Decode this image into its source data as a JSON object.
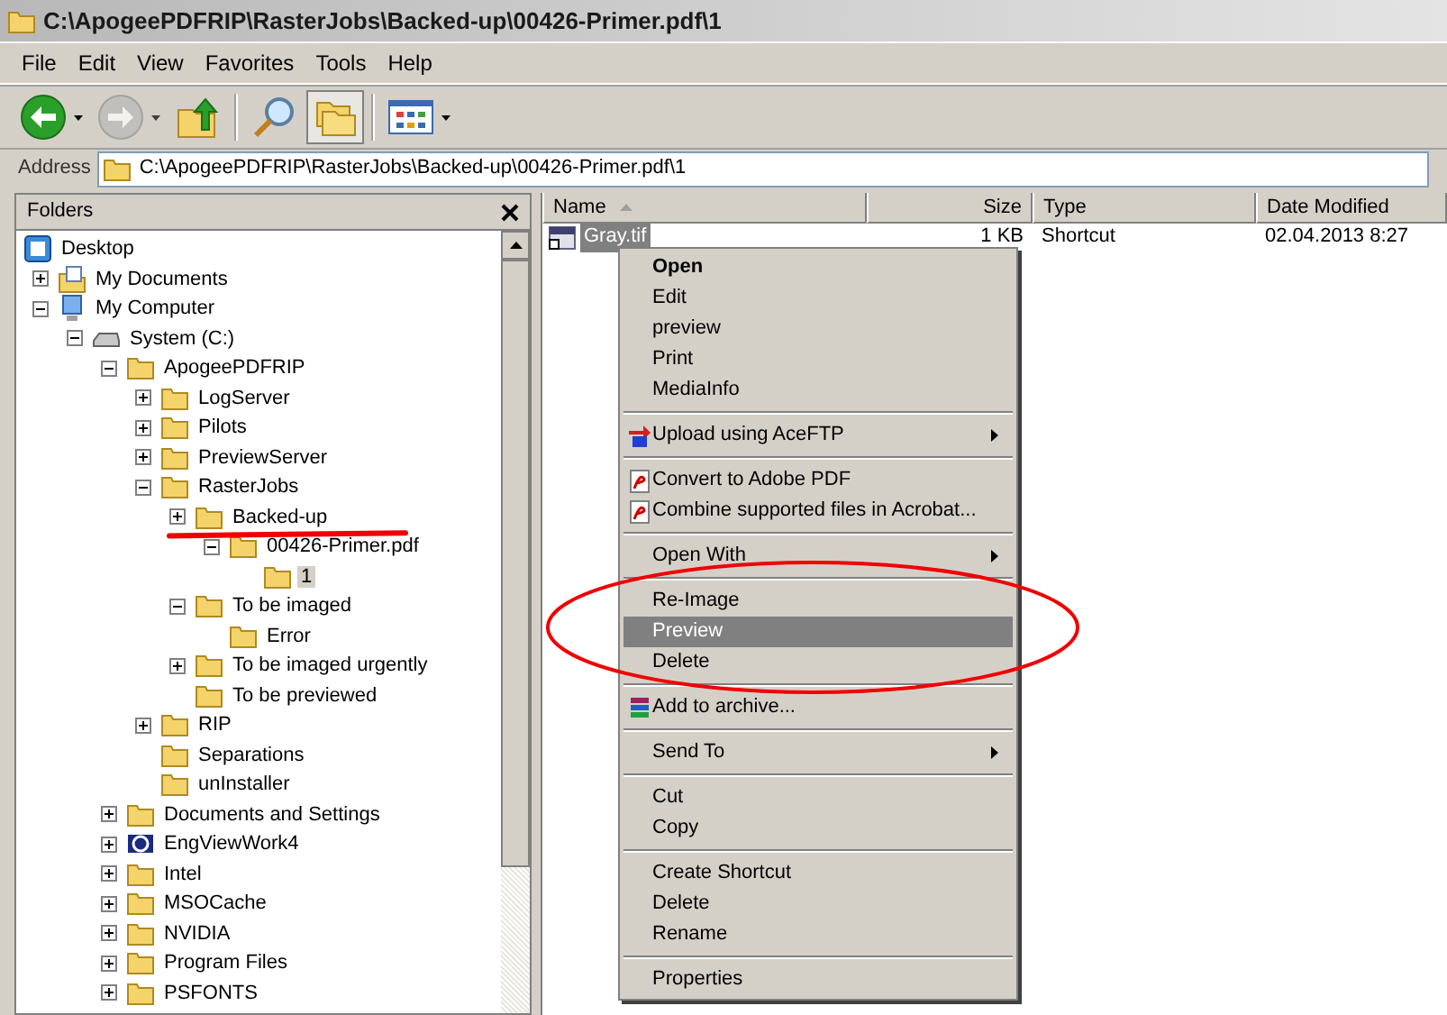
{
  "window": {
    "title": "C:\\ApogeePDFRIP\\RasterJobs\\Backed-up\\00426-Primer.pdf\\1"
  },
  "menu_bar": [
    "File",
    "Edit",
    "View",
    "Favorites",
    "Tools",
    "Help"
  ],
  "toolbar": [
    {
      "kind": "back",
      "disabled": false,
      "on": false
    },
    {
      "kind": "forward",
      "disabled": true,
      "on": false
    },
    {
      "kind": "up",
      "disabled": false,
      "on": false
    },
    {
      "kind": "search",
      "disabled": false,
      "on": false
    },
    {
      "kind": "folders",
      "disabled": false,
      "on": true
    },
    {
      "kind": "views",
      "disabled": false,
      "on": false
    }
  ],
  "address_bar": {
    "label": "Address",
    "value": "C:\\ApogeePDFRIP\\RasterJobs\\Backed-up\\00426-Primer.pdf\\1"
  },
  "folders_pane": {
    "title": "Folders",
    "tree": [
      {
        "label": "Desktop",
        "kind": "desktop",
        "selected": false,
        "children": [
          {
            "label": "My Documents",
            "kind": "documents",
            "expanded": false,
            "selected": false
          },
          {
            "label": "My Computer",
            "kind": "computer",
            "expanded": true,
            "selected": false,
            "children": [
              {
                "label": "System (C:)",
                "kind": "drive",
                "expanded": true,
                "selected": false,
                "children": [
                  {
                    "label": "ApogeePDFRIP",
                    "kind": "folder",
                    "expanded": true,
                    "selected": false,
                    "children": [
                      {
                        "label": "LogServer",
                        "kind": "folder",
                        "expanded": false,
                        "selected": false
                      },
                      {
                        "label": "Pilots",
                        "kind": "folder",
                        "expanded": false,
                        "selected": false
                      },
                      {
                        "label": "PreviewServer",
                        "kind": "folder",
                        "expanded": false,
                        "selected": false
                      },
                      {
                        "label": "RasterJobs",
                        "kind": "folder",
                        "expanded": true,
                        "selected": false,
                        "children": [
                          {
                            "label": "Backed-up",
                            "kind": "folder",
                            "expanded": false,
                            "selected": false,
                            "children": [
                              {
                                "label": "00426-Primer.pdf",
                                "kind": "folder",
                                "expanded": true,
                                "selected": false,
                                "children": [
                                  {
                                    "label": "1",
                                    "kind": "folder",
                                    "selected": true
                                  }
                                ]
                              }
                            ]
                          },
                          {
                            "label": "To be imaged",
                            "kind": "folder",
                            "expanded": true,
                            "selected": false,
                            "children": [
                              {
                                "label": "Error",
                                "kind": "folder",
                                "selected": false
                              }
                            ]
                          },
                          {
                            "label": "To be imaged urgently",
                            "kind": "folder",
                            "expanded": false,
                            "selected": false
                          },
                          {
                            "label": "To be previewed",
                            "kind": "folder",
                            "selected": false
                          }
                        ]
                      },
                      {
                        "label": "RIP",
                        "kind": "folder",
                        "expanded": false,
                        "selected": false
                      },
                      {
                        "label": "Separations",
                        "kind": "folder",
                        "selected": false
                      },
                      {
                        "label": "unInstaller",
                        "kind": "folder",
                        "selected": false
                      }
                    ]
                  },
                  {
                    "label": "Documents and Settings",
                    "kind": "folder",
                    "expanded": false,
                    "selected": false
                  },
                  {
                    "label": "EngViewWork4",
                    "kind": "app",
                    "expanded": false,
                    "selected": false
                  },
                  {
                    "label": "Intel",
                    "kind": "folder",
                    "expanded": false,
                    "selected": false
                  },
                  {
                    "label": "MSOCache",
                    "kind": "folder",
                    "expanded": false,
                    "selected": false
                  },
                  {
                    "label": "NVIDIA",
                    "kind": "folder",
                    "expanded": false,
                    "selected": false
                  },
                  {
                    "label": "Program Files",
                    "kind": "folder",
                    "expanded": false,
                    "selected": false
                  },
                  {
                    "label": "PSFONTS",
                    "kind": "folder",
                    "expanded": false,
                    "selected": false
                  }
                ]
              }
            ]
          }
        ]
      }
    ]
  },
  "file_list": {
    "columns": [
      {
        "label": "Name",
        "sorted": true
      },
      {
        "label": "Size",
        "sorted": false
      },
      {
        "label": "Type",
        "sorted": false
      },
      {
        "label": "Date Modified",
        "sorted": false
      }
    ],
    "rows": [
      {
        "name": "Gray.tif",
        "size": "1 KB",
        "type": "Shortcut",
        "date_modified": "02.04.2013 8:27",
        "selected": true
      }
    ]
  },
  "context_menu": {
    "items": [
      {
        "kind": "plain",
        "label": "Open",
        "bold": true,
        "selected": false,
        "submenu": false
      },
      {
        "kind": "plain",
        "label": "Edit",
        "bold": false,
        "selected": false,
        "submenu": false
      },
      {
        "kind": "plain",
        "label": "preview",
        "bold": false,
        "selected": false,
        "submenu": false
      },
      {
        "kind": "plain",
        "label": "Print",
        "bold": false,
        "selected": false,
        "submenu": false
      },
      {
        "kind": "plain",
        "label": "MediaInfo",
        "bold": false,
        "selected": false,
        "submenu": false
      },
      {
        "kind": "separator"
      },
      {
        "kind": "upload",
        "label": "Upload using AceFTP",
        "bold": false,
        "selected": false,
        "submenu": true
      },
      {
        "kind": "separator"
      },
      {
        "kind": "pdf",
        "label": "Convert to Adobe PDF",
        "bold": false,
        "selected": false,
        "submenu": false
      },
      {
        "kind": "pdf",
        "label": "Combine supported files in Acrobat...",
        "bold": false,
        "selected": false,
        "submenu": false
      },
      {
        "kind": "separator"
      },
      {
        "kind": "plain",
        "label": "Open With",
        "bold": false,
        "selected": false,
        "submenu": true
      },
      {
        "kind": "separator"
      },
      {
        "kind": "plain",
        "label": "Re-Image",
        "bold": false,
        "selected": false,
        "submenu": false
      },
      {
        "kind": "plain",
        "label": "Preview",
        "bold": false,
        "selected": true,
        "submenu": false
      },
      {
        "kind": "plain",
        "label": "Delete",
        "bold": false,
        "selected": false,
        "submenu": false
      },
      {
        "kind": "separator"
      },
      {
        "kind": "archive",
        "label": "Add to archive...",
        "bold": false,
        "selected": false,
        "submenu": false
      },
      {
        "kind": "separator"
      },
      {
        "kind": "plain",
        "label": "Send To",
        "bold": false,
        "selected": false,
        "submenu": true
      },
      {
        "kind": "separator"
      },
      {
        "kind": "plain",
        "label": "Cut",
        "bold": false,
        "selected": false,
        "submenu": false
      },
      {
        "kind": "plain",
        "label": "Copy",
        "bold": false,
        "selected": false,
        "submenu": false
      },
      {
        "kind": "separator"
      },
      {
        "kind": "plain",
        "label": "Create Shortcut",
        "bold": false,
        "selected": false,
        "submenu": false
      },
      {
        "kind": "plain",
        "label": "Delete",
        "bold": false,
        "selected": false,
        "submenu": false
      },
      {
        "kind": "plain",
        "label": "Rename",
        "bold": false,
        "selected": false,
        "submenu": false
      },
      {
        "kind": "separator"
      },
      {
        "kind": "plain",
        "label": "Properties",
        "bold": false,
        "selected": false,
        "submenu": false
      }
    ]
  }
}
